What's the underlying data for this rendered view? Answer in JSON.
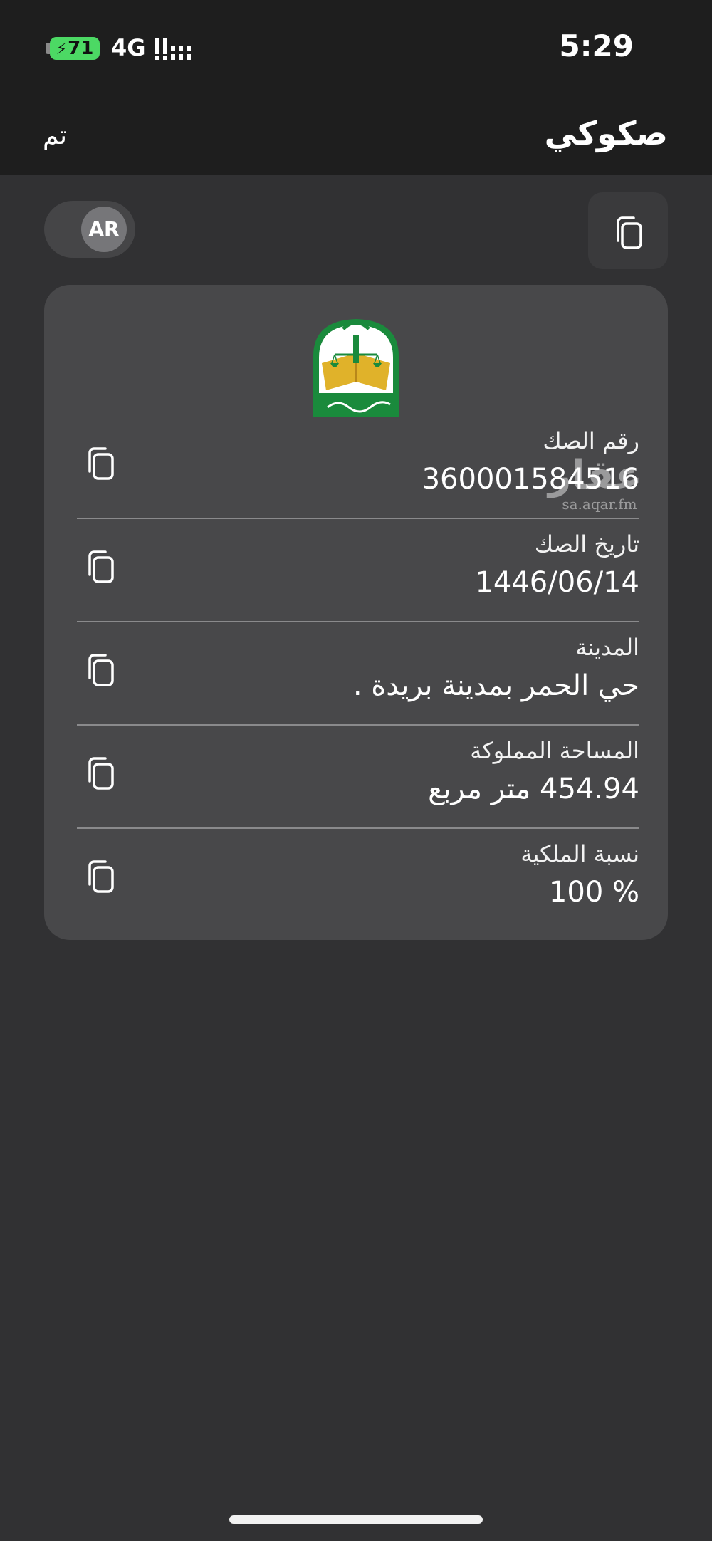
{
  "status_bar": {
    "battery_level": "71",
    "network": "4G",
    "time": "5:29"
  },
  "nav": {
    "title": "صكوكي",
    "done_label": "تم"
  },
  "language_toggle": {
    "label": "AR"
  },
  "deed": {
    "rows": [
      {
        "label": "رقم الصك",
        "value": "360001584516"
      },
      {
        "label": "تاريخ الصك",
        "value": "1446/06/14"
      },
      {
        "label": "المدينة",
        "value": "حي  الحمر  بمدينة بريدة ."
      },
      {
        "label": "المساحة المملوكة",
        "value": "454.94 متر مربع"
      },
      {
        "label": "نسبة الملكية",
        "value": "100 %"
      }
    ]
  },
  "watermark": {
    "logo_text": "عقار",
    "url": "sa.aqar.fm"
  },
  "icons": {
    "copy": "copy-icon",
    "emblem": "ministry-of-justice-emblem",
    "signal": "signal-bars-icon"
  },
  "colors": {
    "background": "#313133",
    "card": "#48484a",
    "bar": "#1e1e1e",
    "battery": "#4cd964",
    "emblem_green": "#1a8a3c",
    "emblem_gold": "#e0b22a"
  }
}
